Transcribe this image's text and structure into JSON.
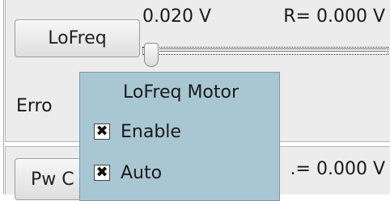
{
  "lofreq_panel": {
    "button_label": "LoFreq",
    "voltage_readout": "0.020 V",
    "r_readout": "R= 0.000 V",
    "error_label": "Erro"
  },
  "pw_panel": {
    "button_label": "Pw C",
    "r_readout": ".= 0.000 V"
  },
  "context_menu": {
    "title": "LoFreq Motor",
    "items": [
      {
        "label": "Enable",
        "checked": true,
        "check_glyph": "✖"
      },
      {
        "label": "Auto",
        "checked": true,
        "check_glyph": "✖"
      }
    ]
  },
  "colors": {
    "panel_bg": "#ececec",
    "popup_bg": "#a9c7d3"
  }
}
